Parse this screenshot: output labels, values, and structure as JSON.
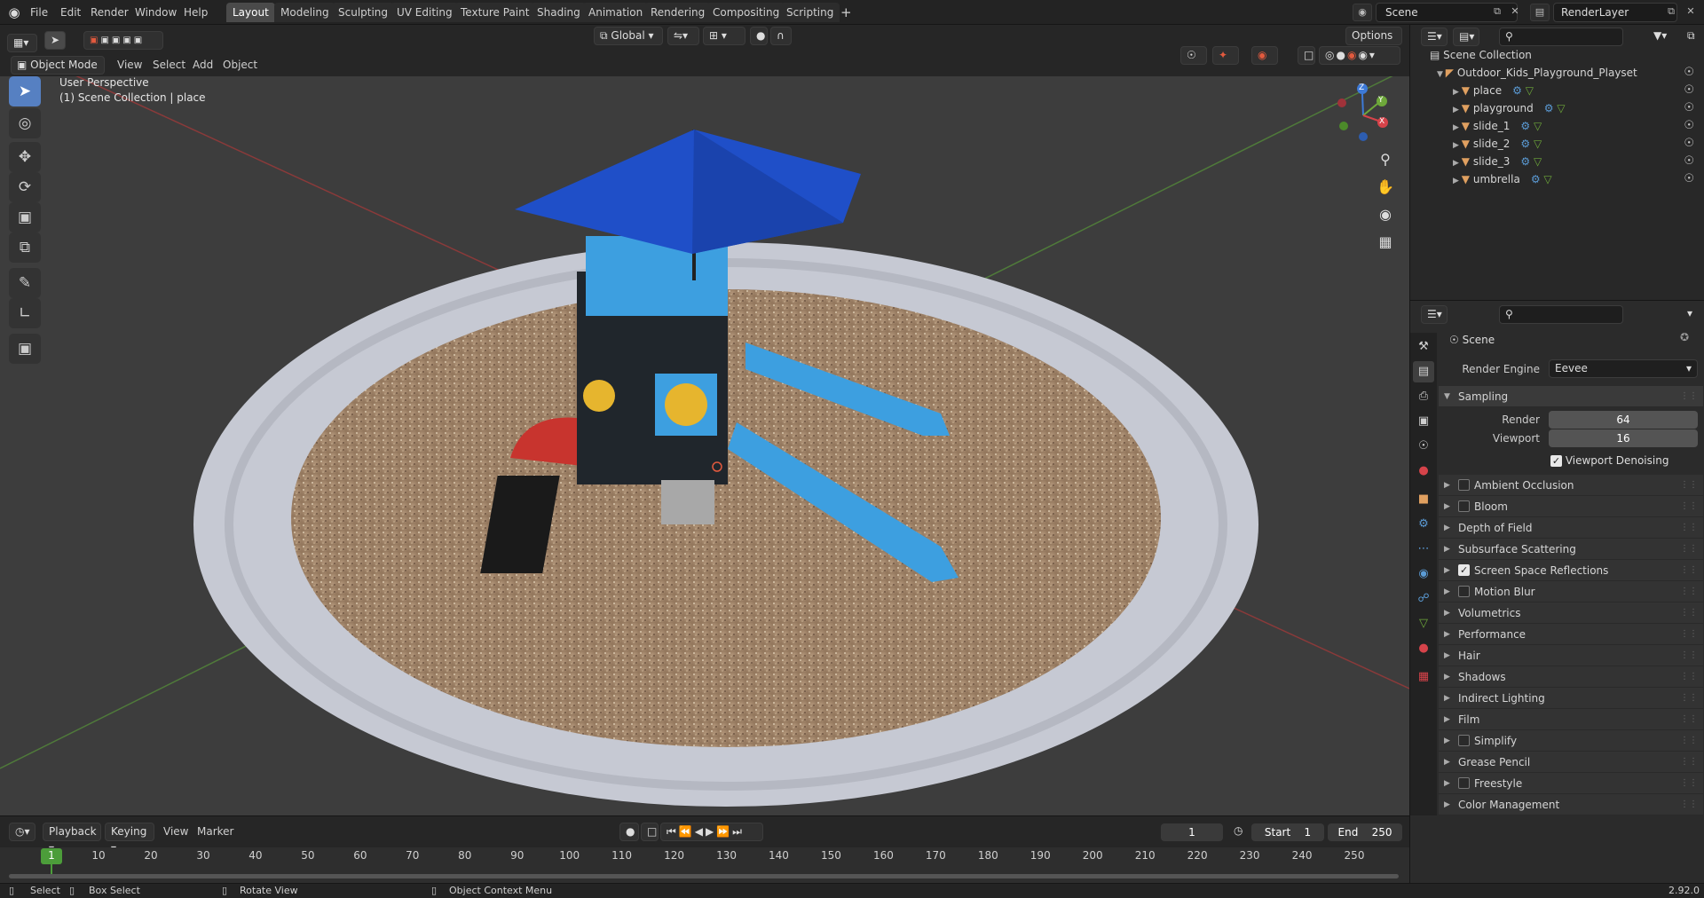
{
  "topbar": {
    "menus": [
      "File",
      "Edit",
      "Render",
      "Window",
      "Help"
    ],
    "workspaces": [
      "Layout",
      "Modeling",
      "Sculpting",
      "UV Editing",
      "Texture Paint",
      "Shading",
      "Animation",
      "Rendering",
      "Compositing",
      "Scripting"
    ],
    "active_workspace": "Layout",
    "scene": "Scene",
    "render_layer": "RenderLayer"
  },
  "viewport_header": {
    "mode": "Object Mode",
    "menus": [
      "View",
      "Select",
      "Add",
      "Object"
    ],
    "transform": "Global",
    "options": "Options"
  },
  "viewport": {
    "perspective": "User Perspective",
    "collection": "(1) Scene Collection | place",
    "gizmo": {
      "x": "X",
      "y": "Y",
      "z": "Z"
    }
  },
  "outliner": {
    "root": "Scene Collection",
    "collection": "Outdoor_Kids_Playground_Playset",
    "objects": [
      "place",
      "playground",
      "slide_1",
      "slide_2",
      "slide_3",
      "umbrella"
    ]
  },
  "properties": {
    "title": "Scene",
    "render_engine_label": "Render Engine",
    "render_engine": "Eevee",
    "sampling": {
      "label": "Sampling",
      "render_label": "Render",
      "render": 64,
      "viewport_label": "Viewport",
      "viewport": 16,
      "denoise_label": "Viewport Denoising"
    },
    "sections": [
      {
        "label": "Ambient Occlusion",
        "checkbox": true,
        "checked": false
      },
      {
        "label": "Bloom",
        "checkbox": true,
        "checked": false
      },
      {
        "label": "Depth of Field",
        "checkbox": false
      },
      {
        "label": "Subsurface Scattering",
        "checkbox": false
      },
      {
        "label": "Screen Space Reflections",
        "checkbox": true,
        "checked": true
      },
      {
        "label": "Motion Blur",
        "checkbox": true,
        "checked": false
      },
      {
        "label": "Volumetrics",
        "checkbox": false
      },
      {
        "label": "Performance",
        "checkbox": false
      },
      {
        "label": "Hair",
        "checkbox": false
      },
      {
        "label": "Shadows",
        "checkbox": false
      },
      {
        "label": "Indirect Lighting",
        "checkbox": false
      },
      {
        "label": "Film",
        "checkbox": false
      },
      {
        "label": "Simplify",
        "checkbox": true,
        "checked": false
      },
      {
        "label": "Grease Pencil",
        "checkbox": false
      },
      {
        "label": "Freestyle",
        "checkbox": true,
        "checked": false
      },
      {
        "label": "Color Management",
        "checkbox": false
      }
    ]
  },
  "timeline": {
    "menus": [
      "Playback",
      "Keying",
      "View",
      "Marker"
    ],
    "current_frame": "1",
    "start_label": "Start",
    "start": "1",
    "end_label": "End",
    "end": "250",
    "ticks": [
      "1",
      "10",
      "20",
      "30",
      "40",
      "50",
      "60",
      "70",
      "80",
      "90",
      "100",
      "110",
      "120",
      "130",
      "140",
      "150",
      "160",
      "170",
      "180",
      "190",
      "200",
      "210",
      "220",
      "230",
      "240",
      "250"
    ]
  },
  "statusbar": {
    "select": "Select",
    "box_select": "Box Select",
    "rotate": "Rotate View",
    "context_menu": "Object Context Menu",
    "version": "2.92.0"
  },
  "colors": {
    "accent": "#4772b3",
    "umbrella": "#1f4fc8",
    "slide": "#3d9fe0",
    "mulch": "#a88c70",
    "border": "#c9ccd6"
  }
}
